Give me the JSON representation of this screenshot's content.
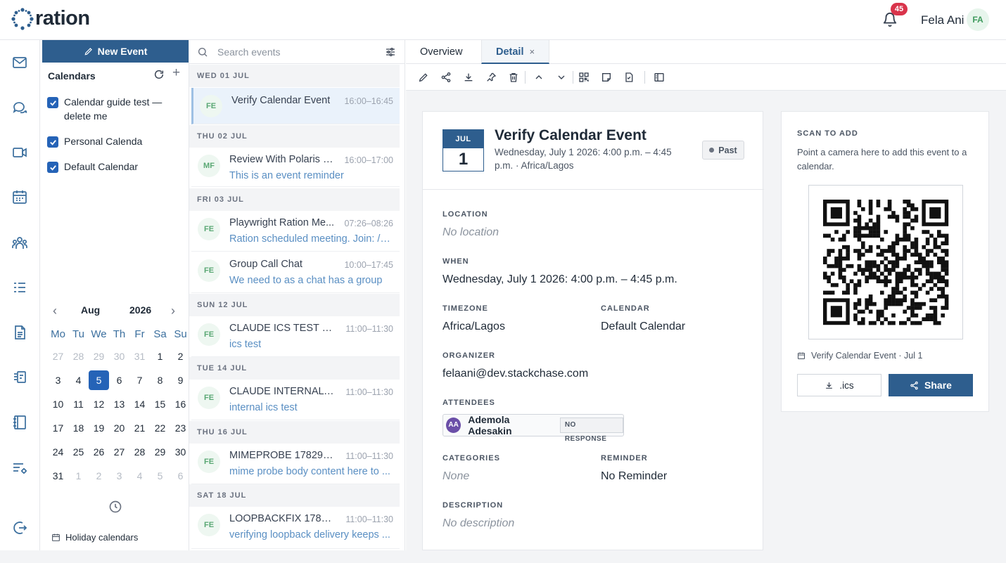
{
  "app": {
    "logo_text": "ration",
    "notification_count": "45",
    "user_name": "Fela Ani",
    "user_initials": "FA"
  },
  "rail_icons": [
    "mail-icon",
    "chat-icon",
    "video-icon",
    "calendar-icon",
    "contacts-icon",
    "tasks-icon",
    "notes-icon",
    "kanban-icon",
    "book-icon",
    "settings-list-icon",
    "logout-icon"
  ],
  "calendars": {
    "new_event_label": "New Event",
    "heading": "Calendars",
    "items": [
      {
        "label": "Calendar guide test — delete me",
        "checked": true
      },
      {
        "label": "Personal Calenda",
        "checked": true
      },
      {
        "label": "Default Calendar",
        "checked": true
      }
    ],
    "holiday_label": "Holiday calendars"
  },
  "mini_calendar": {
    "month": "Aug",
    "year": "2026",
    "weekdays": [
      "Mo",
      "Tu",
      "We",
      "Th",
      "Fr",
      "Sa",
      "Su"
    ],
    "weeks": [
      [
        "27",
        "28",
        "29",
        "30",
        "31",
        "1",
        "2"
      ],
      [
        "3",
        "4",
        "5",
        "6",
        "7",
        "8",
        "9"
      ],
      [
        "10",
        "11",
        "12",
        "13",
        "14",
        "15",
        "16"
      ],
      [
        "17",
        "18",
        "19",
        "20",
        "21",
        "22",
        "23"
      ],
      [
        "24",
        "25",
        "26",
        "27",
        "28",
        "29",
        "30"
      ],
      [
        "31",
        "1",
        "2",
        "3",
        "4",
        "5",
        "6"
      ]
    ],
    "selected": "5"
  },
  "search": {
    "placeholder": "Search events"
  },
  "event_list": {
    "day_headers": [
      "WED 01 JUL",
      "THU 02 JUL",
      "FRI 03 JUL",
      "SUN 12 JUL",
      "TUE 14 JUL",
      "THU 16 JUL",
      "SAT 18 JUL"
    ],
    "events": [
      {
        "initials": "FE",
        "title": "Verify Calendar Event",
        "time": "16:00–16:45",
        "subtitle": ""
      },
      {
        "initials": "MF",
        "title": "Review With Polaris GS",
        "time": "16:00–17:00",
        "subtitle": "This is an event reminder"
      },
      {
        "initials": "FE",
        "title": "Playwright Ration Me...",
        "time": "07:26–08:26",
        "subtitle": "Ration scheduled meeting. Join: /c..."
      },
      {
        "initials": "FE",
        "title": "Group Call Chat",
        "time": "10:00–17:45",
        "subtitle": "We need to as a chat has a group"
      },
      {
        "initials": "FE",
        "title": "CLAUDE ICS TEST 17...",
        "time": "11:00–11:30",
        "subtitle": "ics test"
      },
      {
        "initials": "FE",
        "title": "CLAUDE INTERNAL 1...",
        "time": "11:00–11:30",
        "subtitle": "internal ics test"
      },
      {
        "initials": "FE",
        "title": "MIMEPROBE 1782917...",
        "time": "11:00–11:30",
        "subtitle": "mime probe body content here to ..."
      },
      {
        "initials": "FE",
        "title": "LOOPBACKFIX 17829...",
        "time": "11:00–11:30",
        "subtitle": "verifying loopback delivery keeps ..."
      }
    ]
  },
  "tabs": {
    "overview": "Overview",
    "detail": "Detail",
    "close": "×"
  },
  "toolbar_icons": [
    "edit-icon",
    "share-icon",
    "download-icon",
    "pin-icon",
    "trash-icon",
    "chevron-up-icon",
    "chevron-down-icon",
    "qr-icon",
    "note-icon",
    "task-icon",
    "panel-icon"
  ],
  "detail": {
    "month": "JUL",
    "day": "1",
    "title": "Verify Calendar Event",
    "subtitle": "Wednesday, July 1 2026: 4:00 p.m. – 4:45 p.m. · Africa/Lagos",
    "status": "Past",
    "location_label": "LOCATION",
    "location_value": "No location",
    "when_label": "WHEN",
    "when_value": "Wednesday, July 1 2026: 4:00 p.m. – 4:45 p.m.",
    "timezone_label": "TIMEZONE",
    "timezone_value": "Africa/Lagos",
    "calendar_label": "CALENDAR",
    "calendar_value": "Default Calendar",
    "organizer_label": "ORGANIZER",
    "organizer_value": "felaani@dev.stackchase.com",
    "attendees_label": "ATTENDEES",
    "attendee": {
      "initials": "AA",
      "name": "Ademola Adesakin",
      "status": "NO RESPONSE"
    },
    "categories_label": "CATEGORIES",
    "categories_value": "None",
    "reminder_label": "REMINDER",
    "reminder_value": "No Reminder",
    "description_label": "DESCRIPTION",
    "description_value": "No description"
  },
  "qr": {
    "title": "SCAN TO ADD",
    "description": "Point a camera here to add this event to a calendar.",
    "caption": "Verify Calendar Event · Jul 1",
    "ics_label": ".ics",
    "share_label": "Share"
  },
  "colors": {
    "primary": "#2e5e8e",
    "badge": "#d9344b",
    "accent_blue": "#2563b7"
  }
}
